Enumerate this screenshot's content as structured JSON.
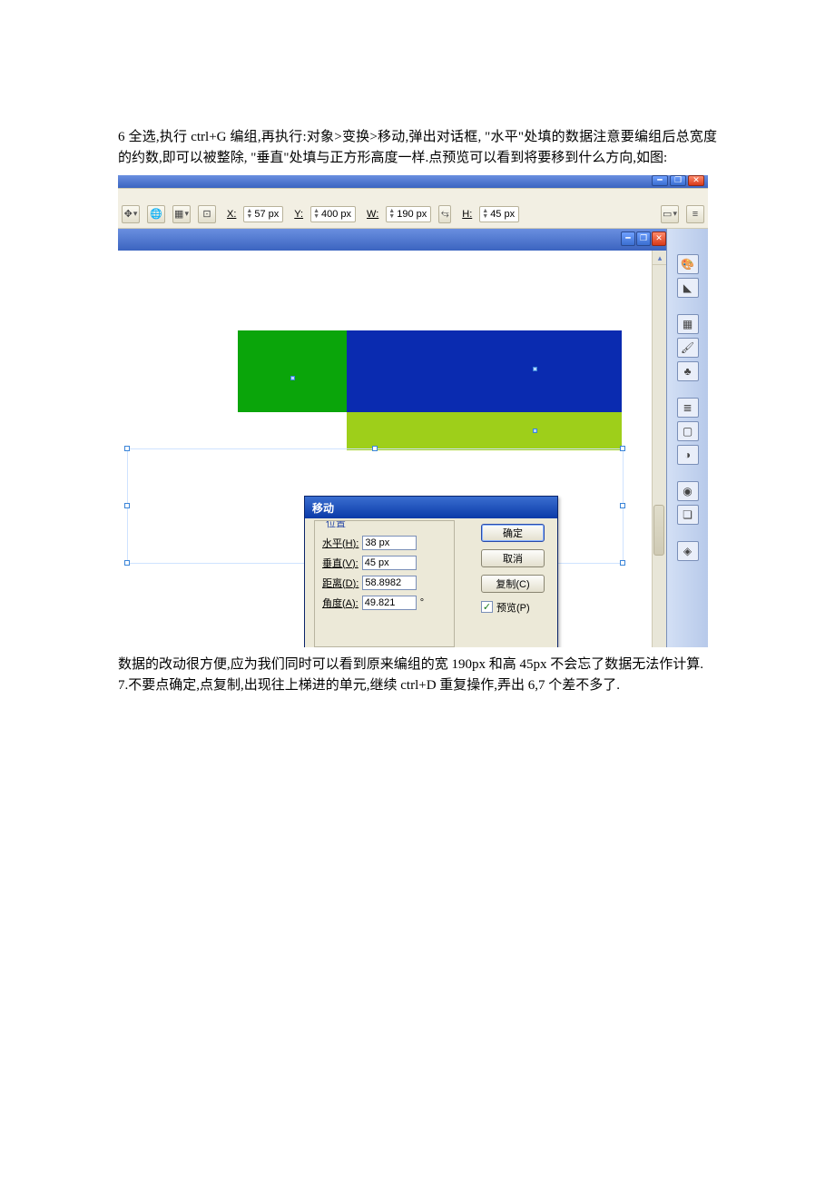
{
  "paragraphs": {
    "p1": "6 全选,执行 ctrl+G 编组,再执行:对象>变换>移动,弹出对话框, \"水平\"处填的数据注意要编组后总宽度的约数,即可以被整除, \"垂直\"处填与正方形高度一样.点预览可以看到将要移到什么方向,如图:",
    "p2": "数据的改动很方便,应为我们同时可以看到原来编组的宽 190px 和高 45px 不会忘了数据无法作计算.",
    "p3": "7.不要点确定,点复制,出现往上梯进的单元,继续 ctrl+D 重复操作,弄出 6,7 个差不多了."
  },
  "optbar": {
    "x_label": "X:",
    "x_value": "57 px",
    "y_label": "Y:",
    "y_value": "400 px",
    "w_label": "W:",
    "w_value": "190 px",
    "h_label": "H:",
    "h_value": "45 px"
  },
  "panel_tab": "◀◀",
  "dialog": {
    "title": "移动",
    "legend": "位置",
    "h_label_pre": "水平(",
    "h_key": "H",
    "h_label_post": "):",
    "h_value": "38 px",
    "v_label_pre": "垂直(",
    "v_key": "V",
    "v_label_post": "):",
    "v_value": "45 px",
    "d_label_pre": "距离(",
    "d_key": "D",
    "d_label_post": "):",
    "d_value": "58.8982",
    "a_label_pre": "角度(",
    "a_key": "A",
    "a_label_post": "):",
    "a_value": "49.821",
    "a_unit": "°",
    "ok": "确定",
    "cancel": "取消",
    "copy": "复制(C)",
    "preview": "预览(P)",
    "preview_checked": "✓"
  }
}
